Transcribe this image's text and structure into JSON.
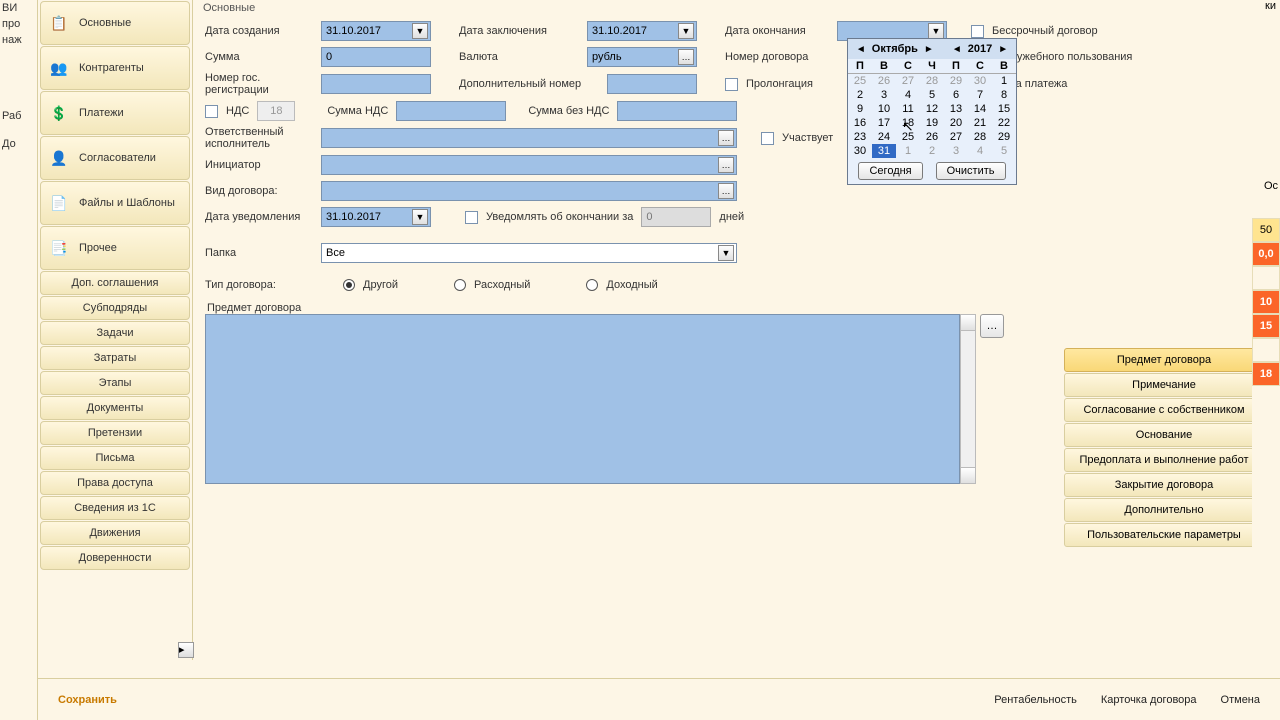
{
  "left_text": {
    "l1": "ВИ",
    "l2": "про",
    "l3": "наж",
    "l4": "Раб",
    "l5": "До",
    "l6": "ки",
    "l7": "Ос"
  },
  "sidebar": [
    {
      "icon": "📋",
      "label": "Основные"
    },
    {
      "icon": "👥",
      "label": "Контрагенты"
    },
    {
      "icon": "💲",
      "label": "Платежи"
    },
    {
      "icon": "👤",
      "label": "Согласователи"
    },
    {
      "icon": "📄",
      "label": "Файлы и Шаблоны"
    },
    {
      "icon": "📑",
      "label": "Прочее"
    }
  ],
  "sidebar2": [
    "Доп. соглашения",
    "Субподряды",
    "Задачи",
    "Затраты",
    "Этапы",
    "Документы",
    "Претензии",
    "Письма",
    "Права доступа",
    "Сведения из 1С",
    "Движения",
    "Доверенности"
  ],
  "form": {
    "group": "Основные",
    "date_create_lbl": "Дата создания",
    "date_create": "31.10.2017",
    "date_sign_lbl": "Дата заключения",
    "date_sign": "31.10.2017",
    "date_end_lbl": "Дата окончания",
    "date_end": "",
    "unlimited_lbl": "Бессрочный договор",
    "sum_lbl": "Сумма",
    "sum": "0",
    "currency_lbl": "Валюта",
    "currency": "рубль",
    "contract_no_lbl": "Номер договора",
    "internal_lbl": "служебного пользования",
    "reg_no_lbl": "Номер гос. регистрации",
    "add_no_lbl": "Дополнительный номер",
    "prolong_lbl": "Пролонгация",
    "delay_lbl": "очка платежа",
    "nds_chk": "НДС",
    "nds_pct": "18",
    "nds_sum_lbl": "Сумма НДС",
    "sum_wo_nds_lbl": "Сумма без НДС",
    "resp_lbl": "Ответственный исполнитель",
    "participates_lbl": "Участвует",
    "initiator_lbl": "Инициатор",
    "type_lbl": "Вид договора:",
    "notify_date_lbl": "Дата уведомления",
    "notify_date": "31.10.2017",
    "notify_end_lbl": "Уведомлять об окончании за",
    "notify_days": "0",
    "days_lbl": "дней",
    "folder_lbl": "Папка",
    "folder": "Все",
    "ctype_lbl": "Тип договора:",
    "ctype_other": "Другой",
    "ctype_expense": "Расходный",
    "ctype_income": "Доходный",
    "subject_lbl": "Предмет договора"
  },
  "calendar": {
    "month": "Октябрь",
    "year": "2017",
    "dows": [
      "П",
      "В",
      "С",
      "Ч",
      "П",
      "С",
      "В"
    ],
    "rows": [
      [
        {
          "d": "25",
          "g": true
        },
        {
          "d": "26",
          "g": true
        },
        {
          "d": "27",
          "g": true
        },
        {
          "d": "28",
          "g": true
        },
        {
          "d": "29",
          "g": true
        },
        {
          "d": "30",
          "g": true
        },
        {
          "d": "1"
        }
      ],
      [
        {
          "d": "2"
        },
        {
          "d": "3"
        },
        {
          "d": "4"
        },
        {
          "d": "5"
        },
        {
          "d": "6"
        },
        {
          "d": "7"
        },
        {
          "d": "8"
        }
      ],
      [
        {
          "d": "9"
        },
        {
          "d": "10"
        },
        {
          "d": "11"
        },
        {
          "d": "12"
        },
        {
          "d": "13"
        },
        {
          "d": "14"
        },
        {
          "d": "15"
        }
      ],
      [
        {
          "d": "16"
        },
        {
          "d": "17"
        },
        {
          "d": "18"
        },
        {
          "d": "19"
        },
        {
          "d": "20"
        },
        {
          "d": "21"
        },
        {
          "d": "22"
        }
      ],
      [
        {
          "d": "23"
        },
        {
          "d": "24"
        },
        {
          "d": "25"
        },
        {
          "d": "26"
        },
        {
          "d": "27"
        },
        {
          "d": "28"
        },
        {
          "d": "29"
        }
      ],
      [
        {
          "d": "30"
        },
        {
          "d": "31",
          "sel": true
        },
        {
          "d": "1",
          "g": true
        },
        {
          "d": "2",
          "g": true
        },
        {
          "d": "3",
          "g": true
        },
        {
          "d": "4",
          "g": true
        },
        {
          "d": "5",
          "g": true
        }
      ]
    ],
    "today": "Сегодня",
    "clear": "Очистить"
  },
  "right_tabs": [
    "Предмет договора",
    "Примечание",
    "Согласование с собственником",
    "Основание",
    "Предоплата и выполнение работ",
    "Закрытие договора",
    "Дополнительно",
    "Пользовательские параметры"
  ],
  "right_strip": {
    "n50": "50",
    "z": "0,0",
    "n10": "10",
    "n15": "15",
    "n18": "18"
  },
  "footer": {
    "save": "Сохранить",
    "rent": "Рентабельность",
    "card": "Карточка договора",
    "cancel": "Отмена"
  }
}
